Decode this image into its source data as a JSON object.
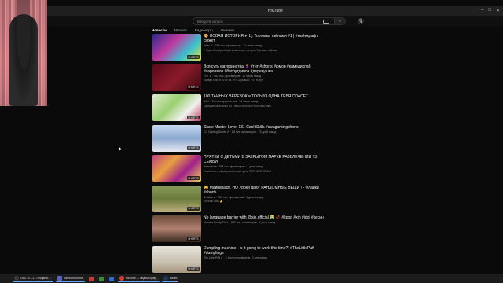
{
  "window": {
    "title": "YouTube"
  },
  "search": {
    "placeholder": "Введите запрос"
  },
  "tabs": [
    {
      "label": "Новости",
      "active": true
    },
    {
      "label": "Музыка",
      "active": false
    },
    {
      "label": "Видеоигры",
      "active": false
    },
    {
      "label": "Фильмы",
      "active": false
    }
  ],
  "videos": [
    {
      "title": "🎨 НОВАЯ ИСТОРИЯ ✔ Ц: Торговка тайнами #1 | #майнкрафт сюжет",
      "sub": "Элис ✔ · 245 тыс. просмотров · 11 часов назад",
      "desc": "✔ https://boosty.to/elisas #майнкрафт история Торговка тайнами",
      "badge": "SHORTS"
    },
    {
      "title": "Вся суть материнства 🤰 #тнт #shorts #юмор #камедиклаб #харламов #батрутдинов #деревушка",
      "sub": "ТНТ ✔ · 662 тыс. просмотров · 10 часов назад",
      "desc": "Камеди Клаб в 22:00 на ТНТ. Отрывок с ТНТ в игре",
      "badge": "SHORTS"
    },
    {
      "title": "100 ТАЙНЫХ ВЕРЕВОК и ТОЛЬКО ОДНА ТЕБЯ СПАСЕТ !",
      "sub": "А4 ✔ · 2,4 млн просмотров · 14 часов назад",
      "desc": "Официальный канал А4 · https://vk.com/a4 и поставь лайк",
      "badge": "SHORTS"
    },
    {
      "title": "Skate Master Level-131 Cool Skills #swagamingshorts",
      "sub": "CG Gaming Shorts ✔ · 1,8 млн просмотров · 15 дней назад",
      "desc": "",
      "badge": "SHORTS"
    },
    {
      "title": "ПРЯТКИ С ДЕТЬМИ В ЗАКРЫТОМ ПАРКЕ РАЗВЛЕЧЕНИЙ ! 3 СЕМЬИ",
      "sub": "Анастасия · 788 тыс. просмотров · 1 день назад",
      "desc": "Семейство и парки развлечений здесь ПАРК ВСЕ СЕМЬИ",
      "badge": "SHORTS"
    },
    {
      "title": "😂 Майнкрафт, НО Уроки дают РАНДОМНЫЕ ВЕЩИ ! - Флайки #shorts",
      "sub": "Флайки ✔ · 769 тыс. просмотров · 1 день назад",
      "desc": "Поставь лайк 👍",
      "badge": "SHORTS"
    },
    {
      "title": "No language barrier with @xin.official 😭 🥀 #kpop #xin #idol #кесин",
      "sub": "Mansha Family TV ✔ · 347 тыс. просмотров · 1 день назад",
      "desc": "",
      "badge": "SHORTS"
    },
    {
      "title": "Dumpling machine - is it going to work this time?! #TheLittlePuff #dumplings",
      "sub": "The Little Puff ✔ · 2,1 млн просмотров · 2 дня назад",
      "desc": "",
      "badge": "SHORTS"
    }
  ],
  "taskbar": [
    {
      "label": "OBS 30.1.2 - Профиль: ...",
      "color": "#3a3a3a"
    },
    {
      "label": "Microsoft Teams",
      "color": "#5a5fc0"
    },
    {
      "label": "",
      "color": "#c03a3a"
    },
    {
      "label": "",
      "color": "#3a8a3a"
    },
    {
      "label": "",
      "color": "#2a6ad0"
    },
    {
      "label": "YouTube — Яндекс Брау...",
      "color": "#d04030"
    },
    {
      "label": "Steam",
      "color": "#1a3a5a"
    }
  ]
}
